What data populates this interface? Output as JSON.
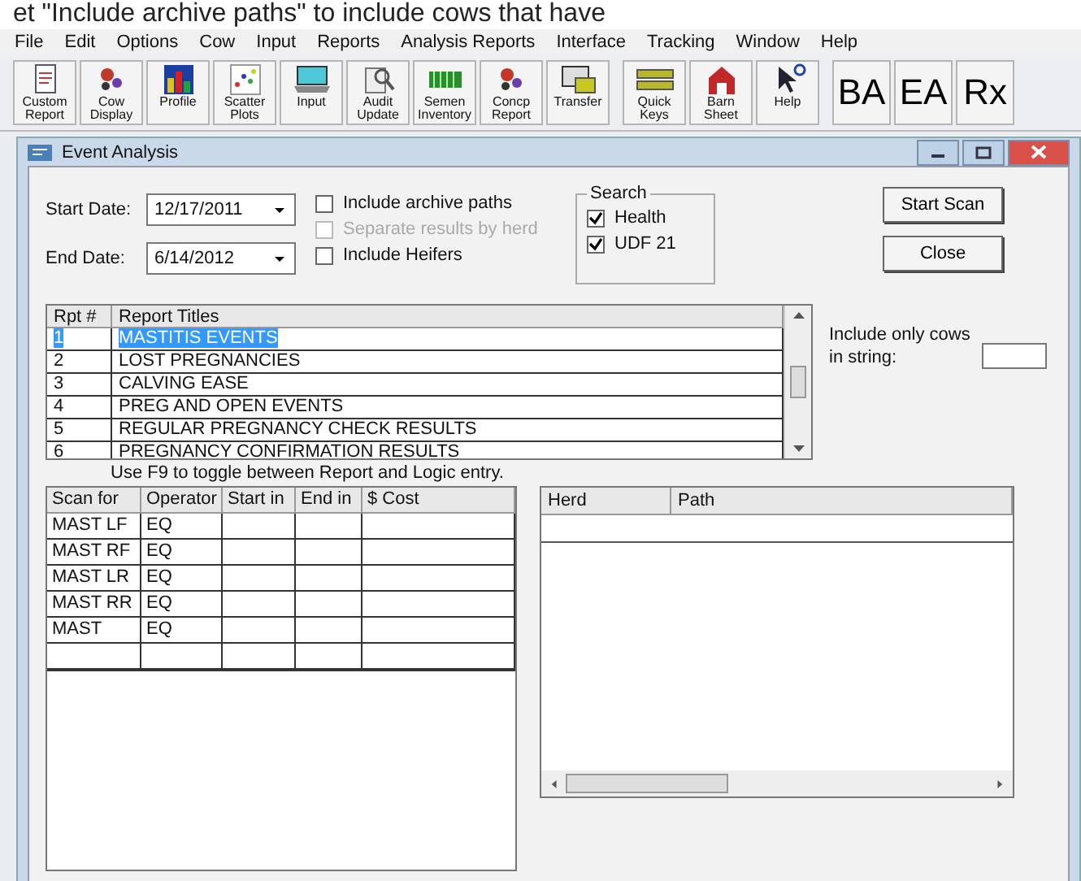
{
  "caption": "et \"Include archive paths\" to include cows that have",
  "menu": [
    "File",
    "Edit",
    "Options",
    "Cow",
    "Input",
    "Reports",
    "Analysis Reports",
    "Interface",
    "Tracking",
    "Window",
    "Help"
  ],
  "toolbar": [
    {
      "kind": "document",
      "label": "Custom Report"
    },
    {
      "kind": "spots",
      "label": "Cow Display"
    },
    {
      "kind": "bars",
      "label": "Profile"
    },
    {
      "kind": "scatter",
      "label": "Scatter Plots"
    },
    {
      "kind": "laptop",
      "label": "Input"
    },
    {
      "kind": "magnifier",
      "label": "Audit Update"
    },
    {
      "kind": "tubes",
      "label": "Semen Inventory"
    },
    {
      "kind": "spots",
      "label": "Concp Report"
    },
    {
      "kind": "monitor",
      "label": "Transfer"
    },
    {
      "kind": "keys",
      "label": "Quick Keys"
    },
    {
      "kind": "barn",
      "label": "Barn Sheet"
    },
    {
      "kind": "pointer",
      "label": "Help"
    },
    {
      "kind": "text",
      "label": "BA"
    },
    {
      "kind": "text",
      "label": "EA"
    },
    {
      "kind": "text",
      "label": "Rx"
    }
  ],
  "window": {
    "title": "Event Analysis"
  },
  "dates": [
    {
      "label": "Start Date:",
      "value": "12/17/2011"
    },
    {
      "label": "End Date:",
      "value": "6/14/2012"
    }
  ],
  "options": [
    {
      "label": "Include archive paths",
      "checked": false,
      "disabled": false
    },
    {
      "label": "Separate results by herd",
      "checked": false,
      "disabled": true
    },
    {
      "label": "Include Heifers",
      "checked": false,
      "disabled": false
    }
  ],
  "search": {
    "title": "Search",
    "items": [
      {
        "label": "Health",
        "checked": true
      },
      {
        "label": "UDF 21",
        "checked": true
      }
    ]
  },
  "buttons": [
    "Start Scan",
    "Close"
  ],
  "report_table": {
    "columns": [
      "Rpt #",
      "Report Titles"
    ],
    "rows": [
      {
        "number": "1",
        "title": "MASTITIS EVENTS",
        "selected": true
      },
      {
        "number": "2",
        "title": "LOST PREGNANCIES",
        "selected": false
      },
      {
        "number": "3",
        "title": "CALVING EASE",
        "selected": false
      },
      {
        "number": "4",
        "title": "PREG AND OPEN EVENTS",
        "selected": false
      },
      {
        "number": "5",
        "title": "REGULAR PREGNANCY CHECK RESULTS",
        "selected": false
      },
      {
        "number": "6",
        "title": "PREGNANCY CONFIRMATION RESULTS",
        "selected": false
      }
    ]
  },
  "string_filter": {
    "label": "Include only cows in string:"
  },
  "hint": "Use F9 to toggle between Report and Logic entry.",
  "logic_table": {
    "columns": [
      "Scan for",
      "Operator",
      "Start in",
      "End in",
      "$ Cost"
    ],
    "rows": [
      {
        "scan_for": "MAST LF",
        "operator": "EQ"
      },
      {
        "scan_for": "MAST RF",
        "operator": "EQ"
      },
      {
        "scan_for": "MAST LR",
        "operator": "EQ"
      },
      {
        "scan_for": "MAST RR",
        "operator": "EQ"
      },
      {
        "scan_for": "MAST",
        "operator": "EQ"
      }
    ]
  },
  "herd_table": {
    "columns": [
      "Herd",
      "Path"
    ]
  }
}
